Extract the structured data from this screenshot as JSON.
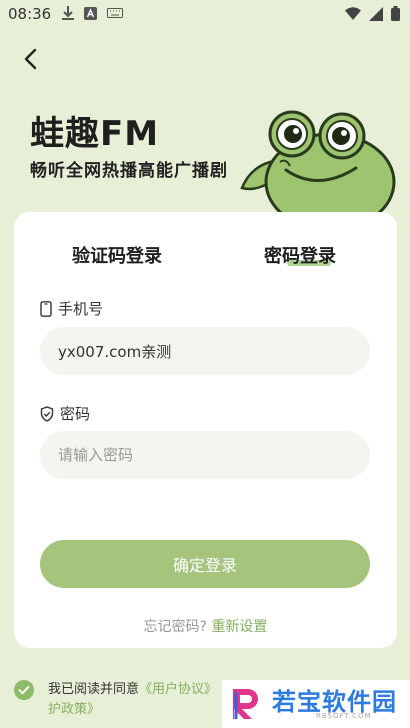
{
  "status_bar": {
    "time": "08:36"
  },
  "brand": {
    "title": "蛙趣FM",
    "subtitle": "畅听全网热播高能广播剧"
  },
  "tabs": {
    "code_login": "验证码登录",
    "password_login": "密码登录"
  },
  "form": {
    "phone_label": "手机号",
    "phone_value": "yx007.com亲测",
    "password_label": "密码",
    "password_placeholder": "请输入密码"
  },
  "login_button": "确定登录",
  "forgot": {
    "question": "忘记密码?",
    "reset": "重新设置"
  },
  "agreement": {
    "prefix": "我已阅读并同意",
    "user_agreement": "《用户协议》",
    "privacy_suffix": "护政策》"
  },
  "watermark": {
    "title": "若宝软件园",
    "site": "RBSOFT.COM"
  },
  "colors": {
    "background": "#e7f0d6",
    "accent": "#a5c57c",
    "link": "#86b05f"
  }
}
